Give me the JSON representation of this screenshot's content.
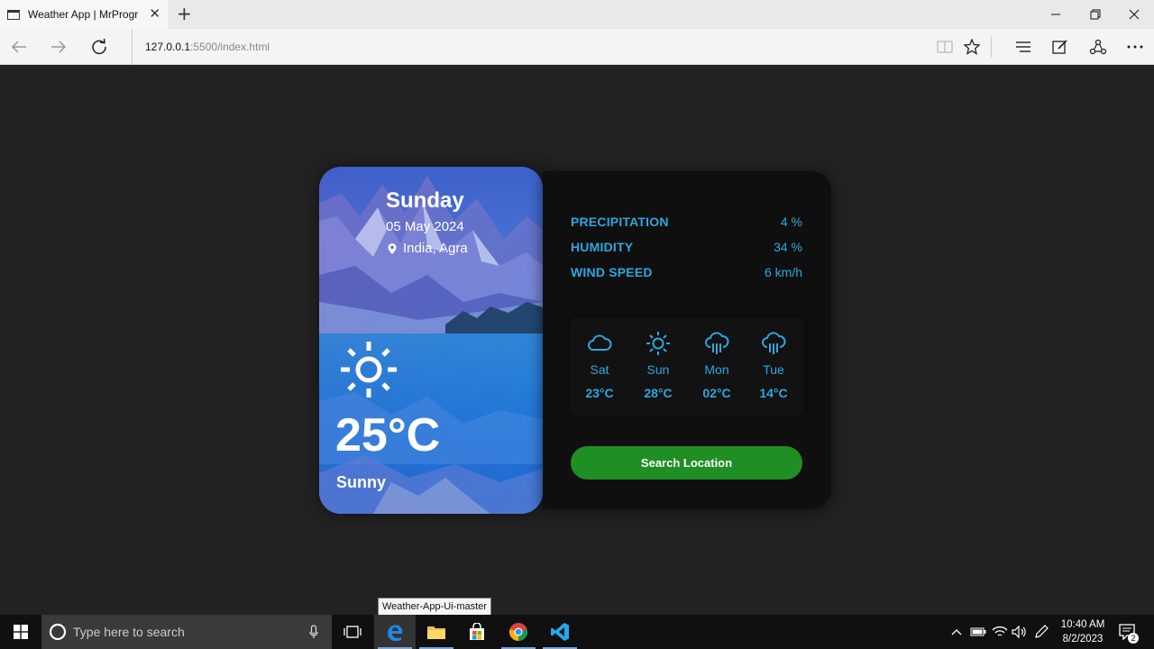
{
  "browser": {
    "tab_title": "Weather App | MrProgr",
    "url_host": "127.0.0.1",
    "url_path": ":5500/index.html"
  },
  "weather": {
    "day": "Sunday",
    "date": "05 May 2024",
    "location": "India, Agra",
    "temperature": "25°C",
    "condition": "Sunny",
    "condition_icon": "sun-icon"
  },
  "stats": [
    {
      "label": "PRECIPITATION",
      "value": "4 %"
    },
    {
      "label": "HUMIDITY",
      "value": "34 %"
    },
    {
      "label": "WIND SPEED",
      "value": "6 km/h"
    }
  ],
  "forecast": [
    {
      "day": "Sat",
      "temp": "23°C",
      "icon": "cloud-icon"
    },
    {
      "day": "Sun",
      "temp": "28°C",
      "icon": "sun-icon"
    },
    {
      "day": "Mon",
      "temp": "02°C",
      "icon": "cloud-rain-icon"
    },
    {
      "day": "Tue",
      "temp": "14°C",
      "icon": "cloud-rain-icon"
    }
  ],
  "search_button_label": "Search Location",
  "tooltip": "Weather-App-Ui-master",
  "taskbar": {
    "search_placeholder": "Type here to search",
    "time": "10:40 AM",
    "date": "8/2/2023",
    "notification_count": "2"
  },
  "colors": {
    "accent": "#2fa6de",
    "button": "#1f8f24",
    "panel": "#0f0f0f",
    "background": "#222222"
  }
}
